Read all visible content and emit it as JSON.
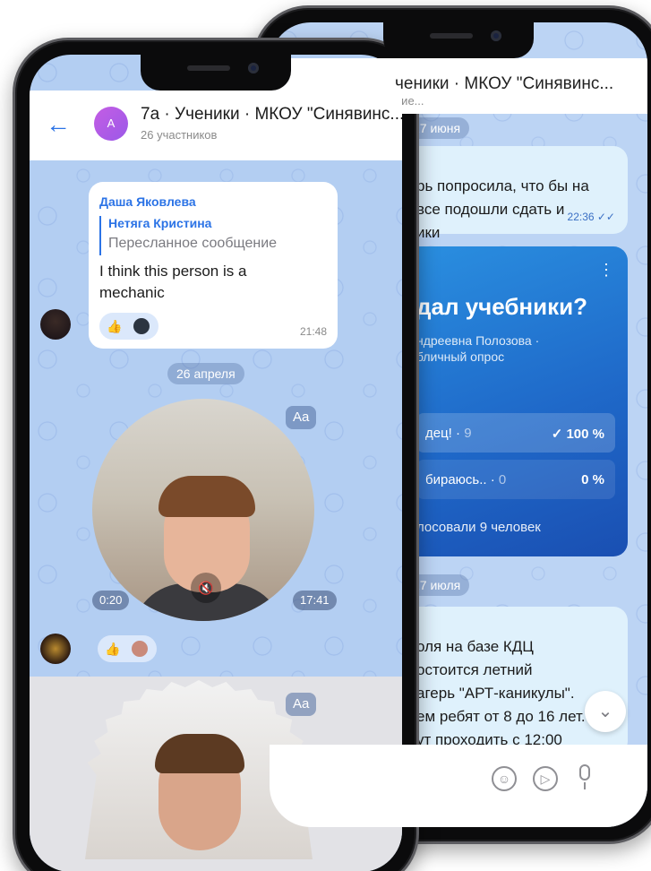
{
  "back_screen": {
    "title": "ченики · МКОУ \"Синявинс...",
    "subtitle": "ние...",
    "date_top": "17 июня",
    "message1": "рь попросила, что бы на\n все подошли сдать и\nики",
    "message1_time": "22:36 ✓✓",
    "poll": {
      "title": "дал учебники?",
      "author": "ндреевна Полозова ·\nбличный опрос",
      "options": [
        {
          "label": "дец!",
          "count": "9",
          "percent": "✓ 100 %"
        },
        {
          "label": "бираюсь..",
          "count": "0",
          "percent": "0 %"
        }
      ],
      "voted": "лосовали 9 человек"
    },
    "date_bottom": "17 июля",
    "message2": "оля на базе КДЦ\nостоится летний\nагерь \"АРТ-каникулы\".\nем ребят от 8 до 16 лет.\nут проходить с 12:00"
  },
  "front_screen": {
    "header": {
      "avatar_letter": "A",
      "title": "7а · Ученики · МКОУ \"Синявинс...",
      "subtitle": "26 участников"
    },
    "message": {
      "sender": "Даша Яковлева",
      "forwarded_from": "Нетяга Кристина",
      "forwarded_note": "Пересланное сообщение",
      "text": "I think this person is a mechanic",
      "time": "21:48"
    },
    "date_pill": "26 апреля",
    "video_note": {
      "aa_label": "Aa",
      "duration": "0:20",
      "time": "17:41"
    },
    "video_note2": {
      "aa_label": "Aa"
    }
  }
}
